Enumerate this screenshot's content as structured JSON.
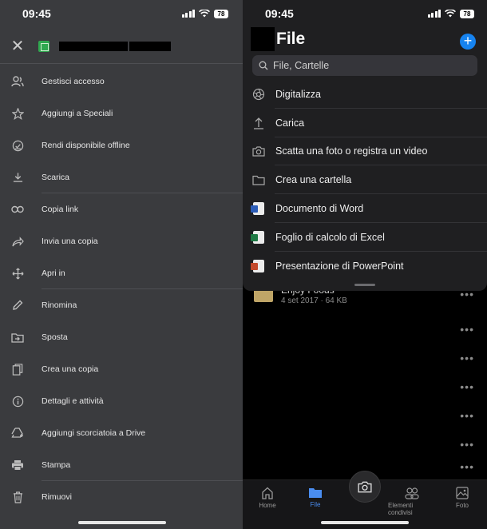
{
  "left": {
    "status": {
      "time": "09:45",
      "battery": "78"
    },
    "menu": [
      {
        "label": "Gestisci accesso",
        "icon": "manage-access-icon"
      },
      {
        "label": "Aggiungi a Speciali",
        "icon": "star-icon"
      },
      {
        "label": "Rendi disponibile offline",
        "icon": "offline-icon"
      },
      {
        "label": "Scarica",
        "icon": "download-icon"
      },
      {
        "label": "Copia link",
        "icon": "link-icon"
      },
      {
        "label": "Invia una copia",
        "icon": "share-icon"
      },
      {
        "label": "Apri in",
        "icon": "open-in-icon"
      },
      {
        "label": "Rinomina",
        "icon": "pencil-icon"
      },
      {
        "label": "Sposta",
        "icon": "move-folder-icon"
      },
      {
        "label": "Crea una copia",
        "icon": "copy-icon"
      },
      {
        "label": "Dettagli e attività",
        "icon": "info-icon"
      },
      {
        "label": "Aggiungi scorciatoia a Drive",
        "icon": "drive-shortcut-icon"
      },
      {
        "label": "Stampa",
        "icon": "print-icon"
      },
      {
        "label": "Rimuovi",
        "icon": "trash-icon"
      }
    ]
  },
  "right": {
    "status": {
      "time": "09:45",
      "battery": "78"
    },
    "title": "File",
    "search": {
      "placeholder": "File, Cartelle"
    },
    "actions": [
      {
        "label": "Digitalizza",
        "icon": "scan-icon"
      },
      {
        "label": "Carica",
        "icon": "upload-icon"
      },
      {
        "label": "Scatta una foto o registra un video",
        "icon": "camera-icon"
      },
      {
        "label": "Crea una cartella",
        "icon": "folder-icon"
      },
      {
        "label": "Documento di Word",
        "icon": "word-icon"
      },
      {
        "label": "Foglio di calcolo di Excel",
        "icon": "excel-icon"
      },
      {
        "label": "Presentazione di PowerPoint",
        "icon": "powerpoint-icon"
      }
    ],
    "file": {
      "name": "Enjoy Foods",
      "meta": "4 set 2017 · 64 KB"
    },
    "tabs": [
      {
        "label": "Home"
      },
      {
        "label": "File"
      },
      {
        "label": "Elementi condivisi"
      },
      {
        "label": "Foto"
      }
    ]
  },
  "colors": {
    "accent": "#1683f0",
    "left_bg": "#3a3b3e",
    "sheet_bg": "#1f1f21"
  }
}
